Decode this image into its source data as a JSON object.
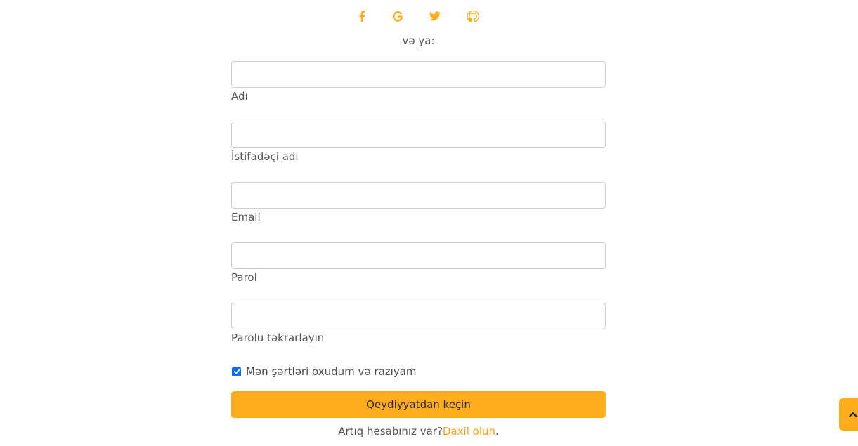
{
  "social": {
    "icons": [
      "facebook-icon",
      "google-icon",
      "twitter-icon",
      "github-icon"
    ],
    "color": "#ffad1d"
  },
  "divider_text": "və ya:",
  "form": {
    "fields": [
      {
        "label": "Adı",
        "value": "",
        "type": "text"
      },
      {
        "label": "İstifadəçi adı",
        "value": "",
        "type": "text"
      },
      {
        "label": "Email",
        "value": "",
        "type": "email"
      },
      {
        "label": "Parol",
        "value": "",
        "type": "password"
      },
      {
        "label": "Parolu təkrarlayın",
        "value": "",
        "type": "password"
      }
    ],
    "terms": {
      "label": "Mən şərtləri oxudum və razıyam",
      "checked": true
    },
    "submit_label": "Qeydiyyatdan keçin",
    "login_prompt": "Artıq hesabınız var?",
    "login_link": "Daxil olun",
    "login_suffix": "."
  },
  "colors": {
    "accent": "#ffad1d",
    "link": "#ff9f1a",
    "checkbox": "#0d6efd"
  },
  "scroll_top_icon": "chevron-up-icon"
}
